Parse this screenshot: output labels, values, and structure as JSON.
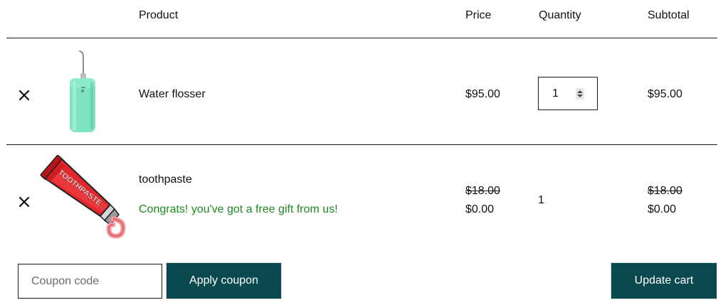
{
  "table": {
    "headers": {
      "product": "Product",
      "price": "Price",
      "quantity": "Quantity",
      "subtotal": "Subtotal"
    }
  },
  "items": [
    {
      "name": "Water flosser",
      "price": "$95.00",
      "quantity": "1",
      "subtotal": "$95.00",
      "thumbnail_icon": "water-flosser-image",
      "remove_icon": "close-icon"
    },
    {
      "name": "toothpaste",
      "note": "Congrats! you've got a free gift from us!",
      "price_original": "$18.00",
      "price": "$0.00",
      "quantity": "1",
      "subtotal_original": "$18.00",
      "subtotal": "$0.00",
      "thumbnail_icon": "toothpaste-tube-image",
      "thumbnail_text": "TOOTHPASTE",
      "remove_icon": "close-icon"
    }
  ],
  "coupon": {
    "placeholder": "Coupon code",
    "value": "",
    "apply_label": "Apply coupon"
  },
  "actions": {
    "update_label": "Update cart"
  },
  "colors": {
    "button_bg": "#0a4a4e",
    "gift_text": "#1f8a1f",
    "border": "#1a1a1a"
  }
}
